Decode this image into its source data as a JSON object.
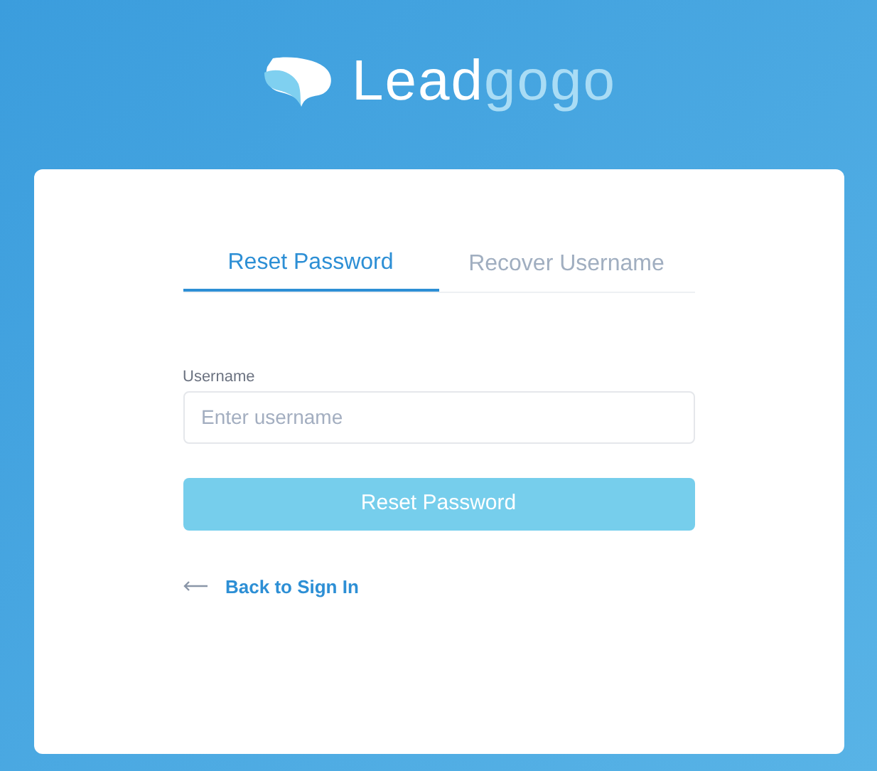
{
  "logo": {
    "primary": "Lead",
    "secondary": "gogo"
  },
  "tabs": [
    {
      "label": "Reset Password",
      "selected": true
    },
    {
      "label": "Recover Username",
      "selected": false
    }
  ],
  "username_field": {
    "label": "Username",
    "placeholder": "Enter username"
  },
  "submit_button": {
    "label": "Reset Password",
    "disabled": true
  },
  "back_link": {
    "label": "Back to Sign In"
  }
}
